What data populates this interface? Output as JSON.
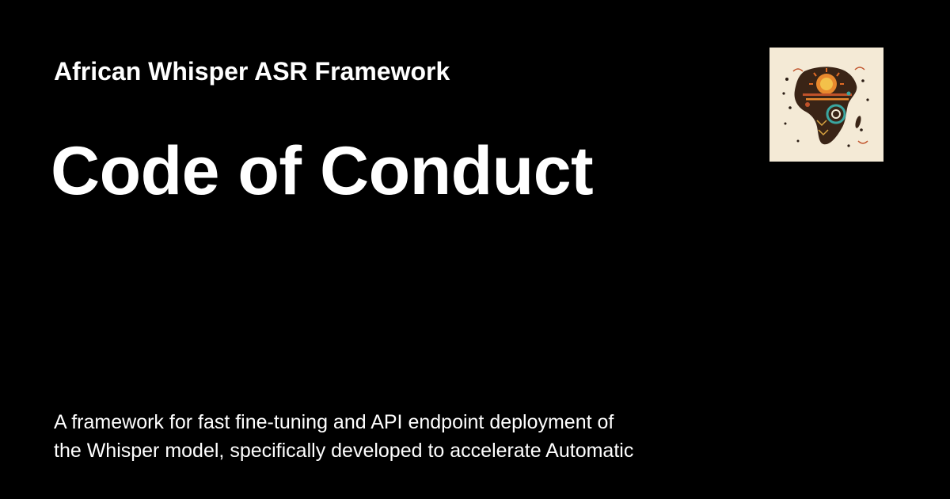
{
  "site": {
    "name": "African Whisper ASR Framework"
  },
  "page": {
    "title": "Code of Conduct",
    "description_line1": "A framework for fast fine-tuning and API endpoint deployment of",
    "description_line2": "the Whisper model, specifically developed to accelerate Automatic"
  },
  "logo": {
    "icon": "africa-map-logo-icon"
  },
  "colors": {
    "background": "#000000",
    "text": "#ffffff",
    "logo_background": "#f4ead6"
  }
}
